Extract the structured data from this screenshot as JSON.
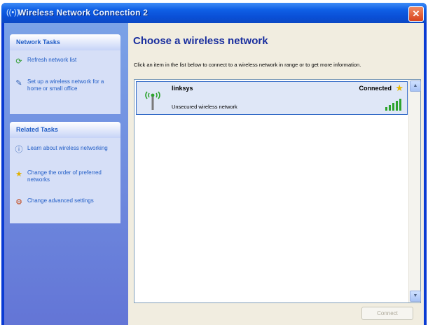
{
  "window": {
    "title": "Wireless Network Connection 2",
    "close_glyph": "✕"
  },
  "sidebar": {
    "network_tasks": {
      "title": "Network Tasks",
      "items": [
        {
          "label": "Refresh network list",
          "icon": "refresh-icon"
        },
        {
          "label": "Set up a wireless network for a home or small office",
          "icon": "setup-wireless-icon"
        }
      ]
    },
    "related_tasks": {
      "title": "Related Tasks",
      "items": [
        {
          "label": "Learn about wireless networking",
          "icon": "info-icon"
        },
        {
          "label": "Change the order of preferred networks",
          "icon": "star-icon"
        },
        {
          "label": "Change advanced settings",
          "icon": "settings-icon"
        }
      ]
    }
  },
  "main": {
    "heading": "Choose a wireless network",
    "instructions": "Click an item in the list below to connect to a wireless network in range or to get more information.",
    "networks": [
      {
        "name": "linksys",
        "status": "Connected",
        "security": "Unsecured wireless network",
        "signal_bars": 5,
        "preferred": true
      }
    ],
    "connect_button": "Connect"
  },
  "colors": {
    "title_bar": "#0a4fd6",
    "sidebar": "#6f8fe0",
    "accent_link": "#215dc6",
    "heading": "#1a2f9e",
    "signal": "#2da32d"
  }
}
